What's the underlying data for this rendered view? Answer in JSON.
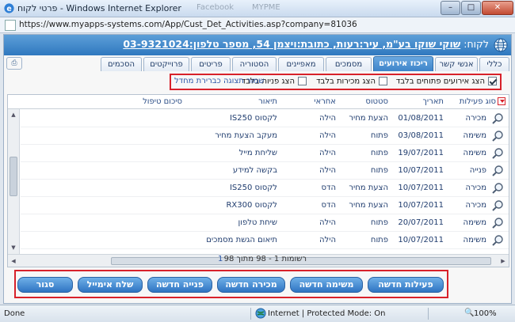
{
  "window": {
    "title": "פרטי לקוח - Windows Internet Explorer",
    "ghost_tab_1": "Facebook",
    "ghost_tab_2": "MYPME"
  },
  "address": {
    "url": "https://www.myapps-systems.com/App/Cust_Det_Activities.asp?company=81036"
  },
  "header": {
    "label": "לקוח:",
    "value": "שוקי שוקו בע\"מ, עיר:רעות, כתובת:ויצמן 54, מספר טלפון:03-9321024"
  },
  "tabs": [
    {
      "label": "כללי",
      "active": false
    },
    {
      "label": "אנשי קשר",
      "active": false
    },
    {
      "label": "ריכוז אירועים",
      "active": true
    },
    {
      "label": "מסמכים",
      "active": false
    },
    {
      "label": "מאפיינים",
      "active": false
    },
    {
      "label": "הסטוריה",
      "active": false
    },
    {
      "label": "פריטים",
      "active": false
    },
    {
      "label": "פרוייקטים",
      "active": false
    },
    {
      "label": "הסכמים",
      "active": false
    }
  ],
  "filters": {
    "opt1": "הצג אירועים פתוחים בלבד",
    "opt1_checked": true,
    "opt2": "הצג מכירות בלבד",
    "opt2_checked": false,
    "opt3": "הצג פניות בלבד",
    "opt3_checked": false,
    "save_link": "שמור תצוגה כברירת מחדל"
  },
  "grid": {
    "headers": {
      "type": "סוג פעילות",
      "date": "תאריך",
      "status": "סטטוס",
      "owner": "אחראי",
      "desc": "תיאור",
      "summary": "סיכום טיפול"
    },
    "rows": [
      {
        "type": "מכירה",
        "date": "01/08/2011",
        "status": "הצעת מחיר",
        "owner": "הילה",
        "desc": "לקסוס IS250"
      },
      {
        "type": "משימה",
        "date": "03/08/2011",
        "status": "פתוח",
        "owner": "הילה",
        "desc": "מעקב הצעת מחיר"
      },
      {
        "type": "משימה",
        "date": "19/07/2011",
        "status": "פתוח",
        "owner": "הילה",
        "desc": "שליחת מייל"
      },
      {
        "type": "פנייה",
        "date": "10/07/2011",
        "status": "פתוח",
        "owner": "הילה",
        "desc": "בקשה למידע"
      },
      {
        "type": "מכירה",
        "date": "10/07/2011",
        "status": "הצעת מחיר",
        "owner": "הדס",
        "desc": "לקסוס IS250"
      },
      {
        "type": "מכירה",
        "date": "10/07/2011",
        "status": "הצעת מחיר",
        "owner": "הדס",
        "desc": "לקסוס RX300"
      },
      {
        "type": "משימה",
        "date": "20/07/2011",
        "status": "פתוח",
        "owner": "הילה",
        "desc": "שיחת טלפון"
      },
      {
        "type": "משימה",
        "date": "10/07/2011",
        "status": "פתוח",
        "owner": "הילה",
        "desc": "תיאום הגשת מסמכים"
      }
    ]
  },
  "pager": {
    "records": "רשומות 1 - 98 מתוך 98",
    "page": "1"
  },
  "buttons": {
    "close": "סגור",
    "email": "שלח אימייל",
    "new_request": "פנייה חדשה",
    "new_sale": "מכירה חדשה",
    "new_task": "משימה חדשה",
    "new_activity": "פעילות חדשה"
  },
  "status": {
    "done": "Done",
    "zone": "Internet | Protected Mode: On",
    "zoom": "100%"
  }
}
